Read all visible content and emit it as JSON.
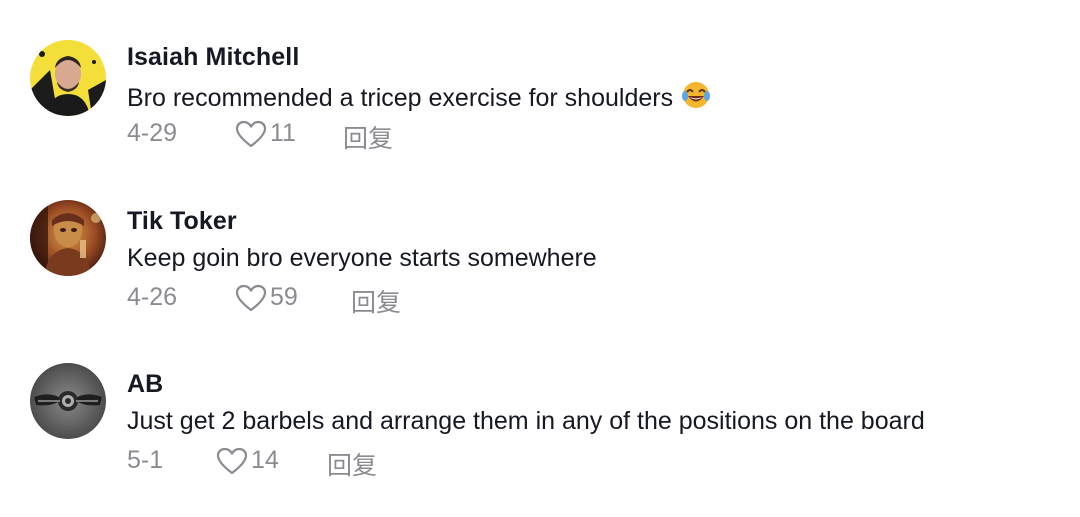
{
  "comments": [
    {
      "author": "Isaiah Mitchell",
      "text": "Bro recommended a tricep exercise for shoulders",
      "emoji": "face-with-tears-of-joy",
      "date": "4-29",
      "likes": "11",
      "reply_label": "回复"
    },
    {
      "author": "Tik Toker",
      "text": "Keep goin bro everyone starts somewhere",
      "date": "4-26",
      "likes": "59",
      "reply_label": "回复"
    },
    {
      "author": "AB",
      "text": "Just get 2 barbels and arrange them in any of the positions on the board",
      "date": "5-1",
      "likes": "14",
      "reply_label": "回复"
    }
  ],
  "colors": {
    "primary_text": "#161823",
    "secondary_text": "#8a8b91"
  },
  "icons": {
    "like": "heart-outline-icon"
  }
}
